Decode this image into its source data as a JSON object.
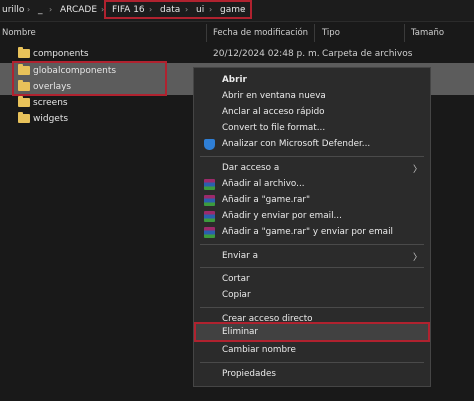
{
  "breadcrumb": {
    "items": [
      "urillo",
      "_",
      "ARCADE",
      "FIFA 16",
      "data",
      "ui",
      "game"
    ],
    "separator": "›"
  },
  "columns": [
    "Nombre",
    "Fecha de modificación",
    "Tipo",
    "Tamaño"
  ],
  "files": [
    {
      "name": "components",
      "date": "20/12/2024 02:48 p. m.",
      "type": "Carpeta de archivos"
    },
    {
      "name": "globalcomponents",
      "date": "",
      "type": ""
    },
    {
      "name": "overlays",
      "date": "",
      "type": ""
    },
    {
      "name": "screens",
      "date": "",
      "type": ""
    },
    {
      "name": "widgets",
      "date": "",
      "type": ""
    }
  ],
  "context_menu": {
    "abrir": "Abrir",
    "abrir_ventana": "Abrir en ventana nueva",
    "anclar": "Anclar al acceso rápido",
    "convert": "Convert to file format...",
    "defender": "Analizar con Microsoft Defender...",
    "dar_acceso": "Dar acceso a",
    "anadir_archivo": "Añadir al archivo...",
    "anadir_rar": "Añadir a \"game.rar\"",
    "anadir_email": "Añadir y enviar por email...",
    "anadir_rar_email": "Añadir a \"game.rar\" y enviar por email",
    "enviar": "Enviar a",
    "cortar": "Cortar",
    "copiar": "Copiar",
    "crear_acceso": "Crear acceso directo",
    "eliminar": "Eliminar",
    "cambiar_nombre": "Cambiar nombre",
    "propiedades": "Propiedades"
  },
  "colors": {
    "highlight_border": "#b0222f",
    "folder": "#e8c25a",
    "background": "#191919"
  }
}
